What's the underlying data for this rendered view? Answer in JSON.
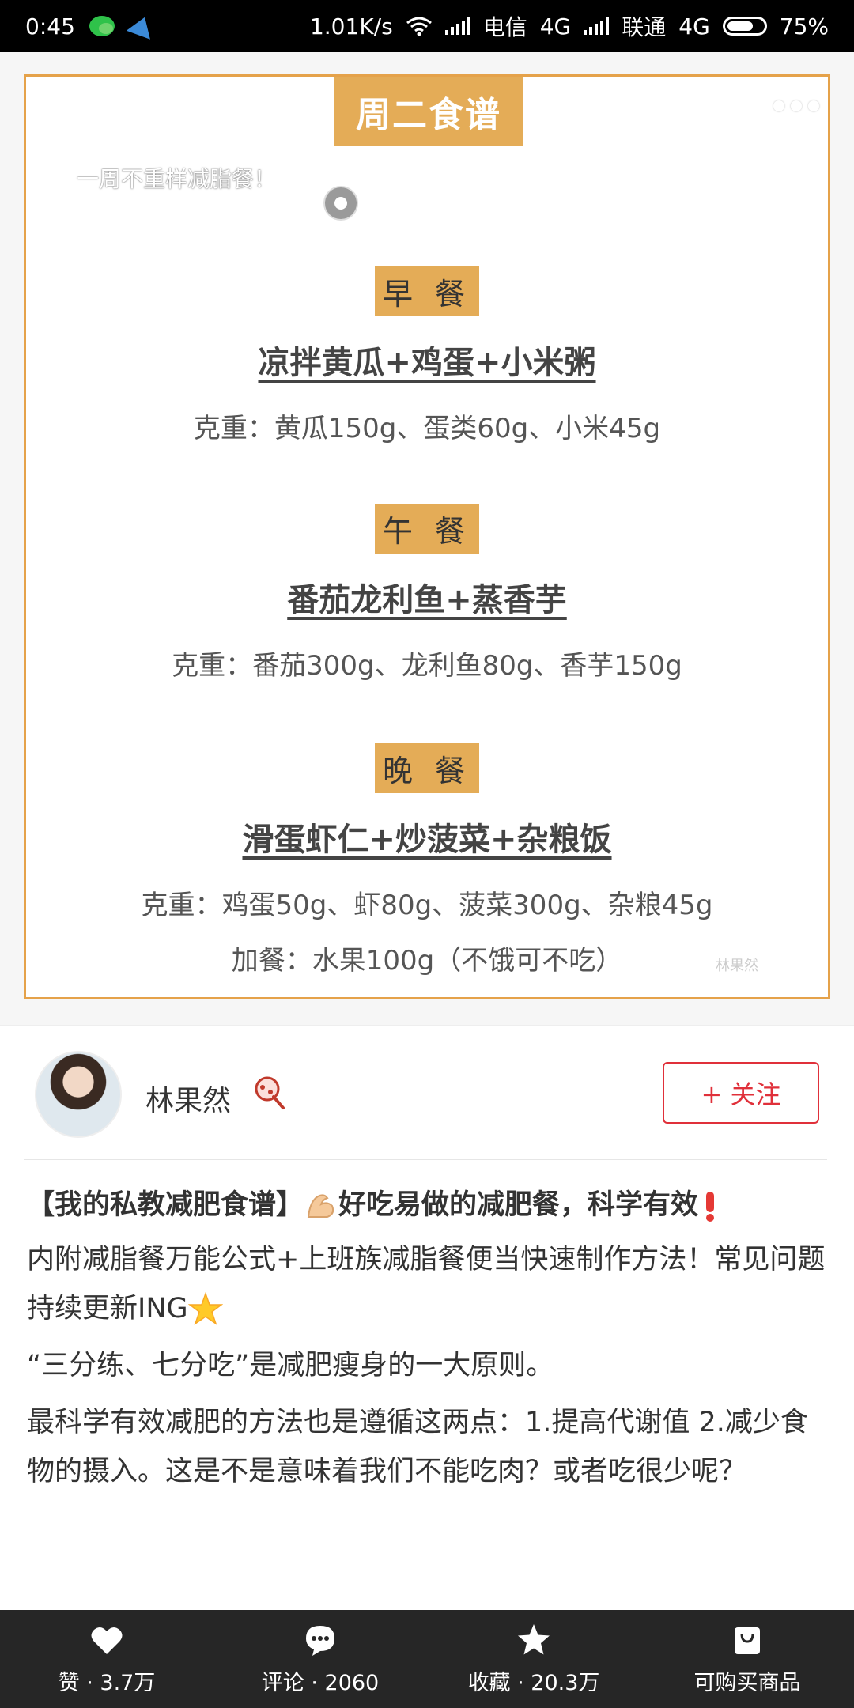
{
  "status_bar": {
    "time": "0:45",
    "speed": "1.01K/s",
    "carrier1": "电信",
    "net1": "4G",
    "carrier2": "联通",
    "net2": "4G",
    "battery": "75%"
  },
  "poster": {
    "title": "周二食谱",
    "subtitle": "一周不重样减脂餐！",
    "meals": [
      {
        "tag": "早 餐",
        "dish": "凉拌黄瓜+鸡蛋+小米粥",
        "weight": "克重：黄瓜150g、蛋类60g、小米45g"
      },
      {
        "tag": "午 餐",
        "dish": "番茄龙利鱼+蒸香芋",
        "weight": "克重：番茄300g、龙利鱼80g、香芋150g"
      },
      {
        "tag": "晚 餐",
        "dish": "滑蛋虾仁+炒菠菜+杂粮饭",
        "weight": "克重：鸡蛋50g、虾80g、菠菜300g、杂粮45g"
      }
    ],
    "extra": "加餐：水果100g（不饿可不吃）",
    "watermark": "林果然"
  },
  "author": {
    "name": "林果然",
    "follow_label": "+ 关注"
  },
  "post": {
    "title_a": "【我的私教减肥食谱】",
    "title_b": "好吃易做的减肥餐，科学有效",
    "para1": "内附减脂餐万能公式+上班族减脂餐便当快速制作方法！常见问题持续更新ING",
    "para2": "“三分练、七分吃”是减肥瘦身的一大原则。",
    "para3": "最科学有效减肥的方法也是遵循这两点：1.提高代谢值 2.减少食物的摄入。这是不是意味着我们不能吃肉？或者吃很少呢？"
  },
  "bottom_bar": {
    "like": "赞 · 3.7万",
    "comment": "评论 · 2060",
    "collect": "收藏 · 20.3万",
    "shop": "可购买商品"
  },
  "colors": {
    "accent_orange": "#e4ac57",
    "follow_red": "#e0303a",
    "bottom_bar": "#262626"
  }
}
